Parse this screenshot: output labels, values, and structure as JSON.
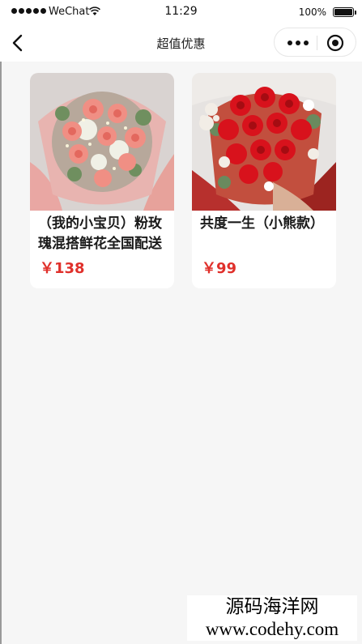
{
  "status_bar": {
    "carrier": "WeChat",
    "time": "11:29",
    "battery_percent": "100%",
    "signal_icon": "signal-dots-icon",
    "wifi_icon": "wifi-icon",
    "battery_icon": "battery-icon"
  },
  "nav": {
    "title": "超值优惠",
    "back_icon": "chevron-left-icon",
    "more_icon": "more-dots-icon",
    "close_icon": "miniprogram-close-icon"
  },
  "products": [
    {
      "name": "（我的小宝贝）粉玫瑰混搭鲜花全国配送",
      "price": "￥138",
      "image_desc": "pink-rose-bouquet-image"
    },
    {
      "name": "共度一生（小熊款）",
      "price": "￥99",
      "image_desc": "red-rose-bouquet-with-bears-image"
    }
  ],
  "watermark": {
    "line1": "源码海洋网",
    "line2": "www.codehy.com"
  },
  "colors": {
    "price": "#e0302b",
    "background": "#f6f6f6"
  }
}
